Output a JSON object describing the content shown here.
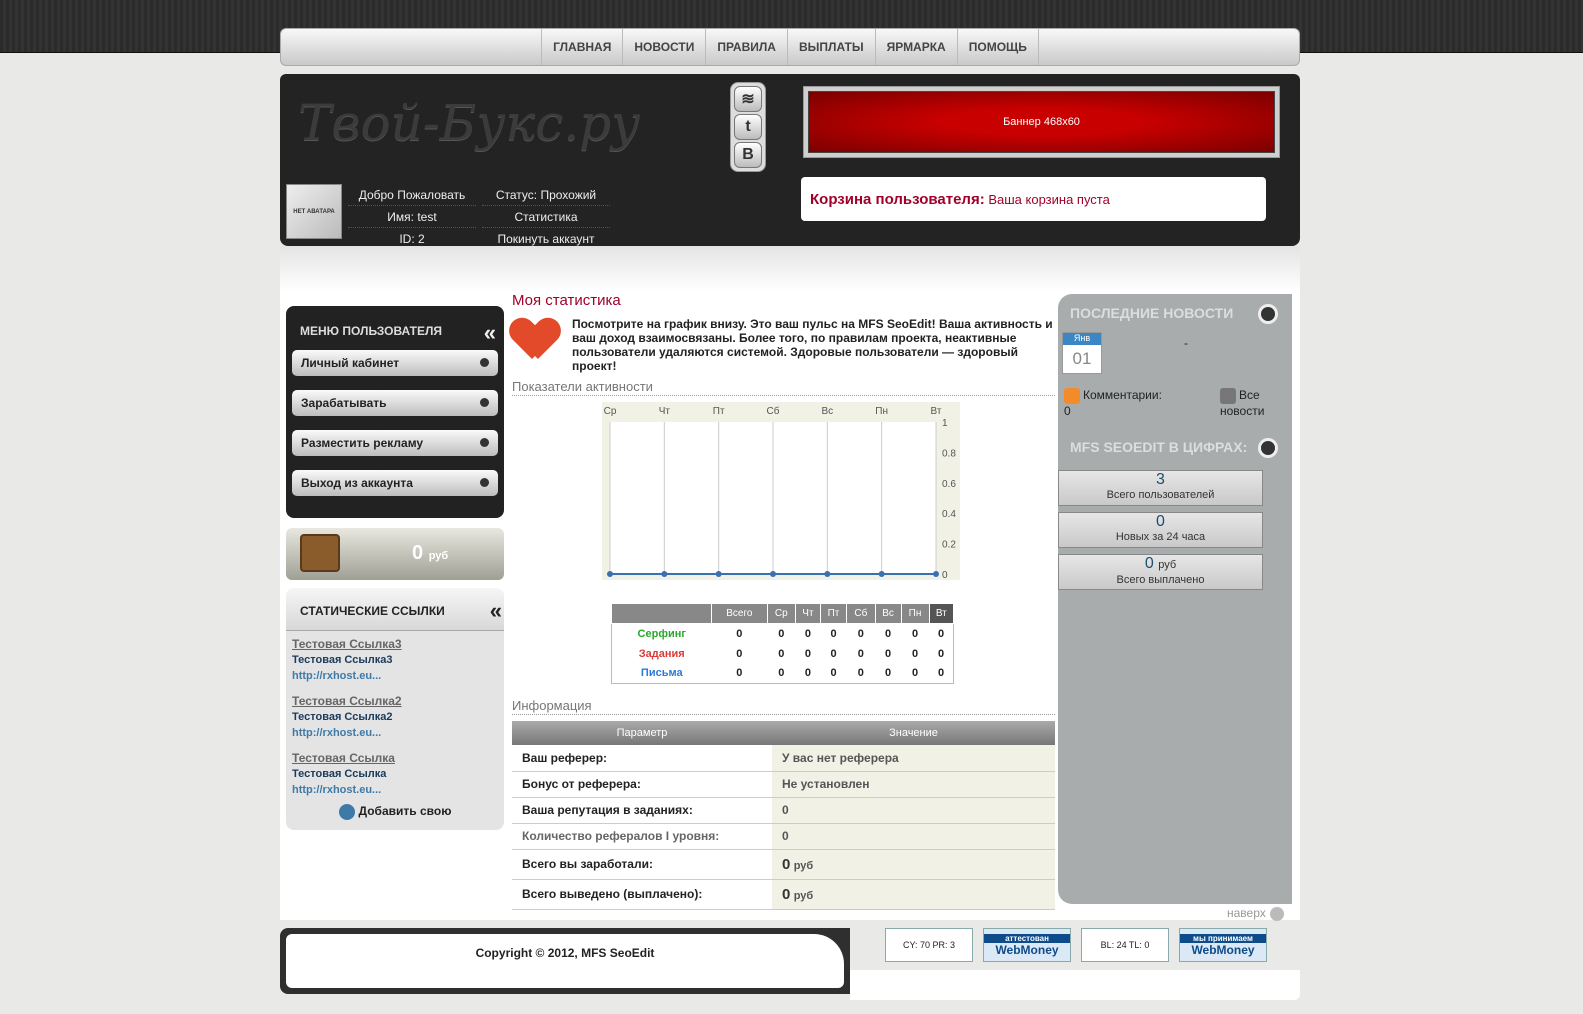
{
  "nav": [
    "ГЛАВНАЯ",
    "НОВОСТИ",
    "ПРАВИЛА",
    "ВЫПЛАТЫ",
    "ЯРМАРКА",
    "ПОМОЩЬ"
  ],
  "header": {
    "logo": "Твой-Букс.ру",
    "banner": "Баннер 468x60",
    "social": [
      "rss-icon",
      "tumblr-icon",
      "vk-icon"
    ]
  },
  "user": {
    "avatar_text": "НЕТ АВАТАРА",
    "welcome": "Добро Пожаловать",
    "name": "Имя: test",
    "id": "ID: 2",
    "status": "Статус: Прохожий",
    "stats": "Статистика",
    "logout": "Покинуть аккаунт"
  },
  "cart": {
    "title": "Корзина пользователя:",
    "text": "Ваша корзина пуста"
  },
  "menu": {
    "title": "МЕНЮ ПОЛЬЗОВАТЕЛЯ",
    "items": [
      "Личный кабинет",
      "Зарабатывать",
      "Разместить рекламу",
      "Выход из аккаунта"
    ]
  },
  "wallet": {
    "amount": "0",
    "unit": "руб"
  },
  "static": {
    "title": "СТАТИЧЕСКИЕ ССЫЛКИ",
    "links": [
      {
        "title": "Тестовая Ссылка3",
        "desc": "Тестовая Ссылка3",
        "url": "http://rxhost.eu..."
      },
      {
        "title": "Тестовая Ссылка2",
        "desc": "Тестовая Ссылка2",
        "url": "http://rxhost.eu..."
      },
      {
        "title": "Тестовая Ссылка",
        "desc": "Тестовая Ссылка",
        "url": "http://rxhost.eu..."
      }
    ],
    "add": "Добавить свою"
  },
  "main": {
    "title": "Моя статистика",
    "intro": "Посмотрите на график внизу. Это ваш пульс на MFS SeoEdit! Ваша активность и ваш доход взаимосвязаны. Более того, по правилам проекта, неактивные пользователи удаляются системой. Здоровые пользователи — здоровый проект!",
    "activity": "Показатели активности",
    "info": "Информация"
  },
  "chart_data": {
    "type": "line",
    "categories": [
      "Ср",
      "Чт",
      "Пт",
      "Сб",
      "Вс",
      "Пн",
      "Вт"
    ],
    "values": [
      0,
      0,
      0,
      0,
      0,
      0,
      0
    ],
    "yticks": [
      "1",
      "0.8",
      "0.6",
      "0.4",
      "0.2",
      "0"
    ],
    "ylim": [
      0,
      1
    ]
  },
  "stat_table": {
    "headers": [
      "Всего",
      "Ср",
      "Чт",
      "Пт",
      "Сб",
      "Вс",
      "Пн",
      "Вт"
    ],
    "rows": [
      {
        "label": "Серфинг",
        "color": "#2aa82a",
        "values": [
          "0",
          "0",
          "0",
          "0",
          "0",
          "0",
          "0",
          "0"
        ]
      },
      {
        "label": "Задания",
        "color": "#d83a3a",
        "values": [
          "0",
          "0",
          "0",
          "0",
          "0",
          "0",
          "0",
          "0"
        ]
      },
      {
        "label": "Письма",
        "color": "#2a7ad8",
        "values": [
          "0",
          "0",
          "0",
          "0",
          "0",
          "0",
          "0",
          "0"
        ]
      }
    ]
  },
  "info_table": {
    "headers": [
      "Параметр",
      "Значение"
    ],
    "rows": [
      {
        "k": "Ваш реферер:",
        "v": "У вас нет реферера"
      },
      {
        "k": "Бонус от реферера:",
        "v": "Не установлен"
      },
      {
        "k": "Ваша репутация в заданиях:",
        "v": "0"
      },
      {
        "k": "Количество рефералов I уровня:",
        "v": "0"
      }
    ],
    "earned": {
      "k": "Всего вы заработали:",
      "v": "0",
      "unit": "руб"
    },
    "paid": {
      "k": "Всего выведено (выплачено):",
      "v": "0",
      "unit": "руб"
    }
  },
  "news": {
    "title": "ПОСЛЕДНИЕ НОВОСТИ",
    "month": "Янв",
    "day": "01",
    "dash": "-",
    "comments": "Комментарии:",
    "comments_count": "0",
    "all": "Все новости"
  },
  "figures": {
    "title": "MFS SEOEDIT В ЦИФРАХ:",
    "items": [
      {
        "value": "3",
        "unit": "",
        "label": "Всего пользователей"
      },
      {
        "value": "0",
        "unit": "",
        "label": "Новых за 24 часа"
      },
      {
        "value": "0",
        "unit": "руб",
        "label": "Всего выплачено"
      }
    ]
  },
  "footer": {
    "copyright": "Copyright © 2012, MFS SeoEdit",
    "top": "наверх",
    "counter": "CY: 70 PR: 3",
    "wm1_top": "аттестован",
    "wm1": "WebMoney",
    "bl": "BL: 24 TL: 0",
    "wm2_top": "мы принимаем",
    "wm2": "WebMoney"
  }
}
